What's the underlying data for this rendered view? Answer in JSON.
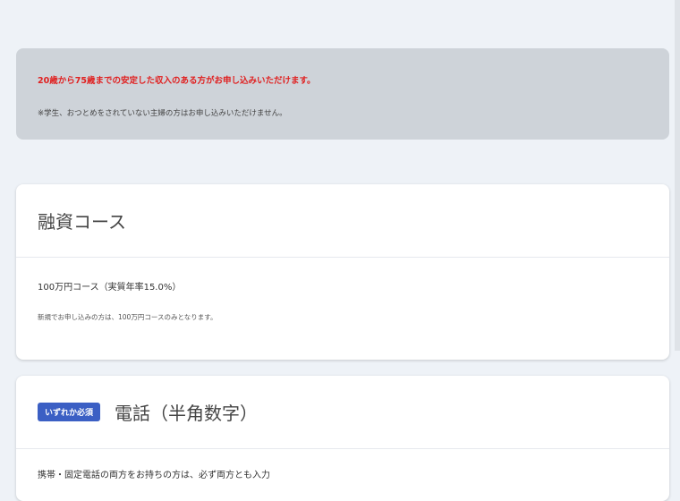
{
  "notice": {
    "warning": "20歳から75歳までの安定した収入のある方がお申し込みいただけます。",
    "sub": "※学生、おつとめをされていない主婦の方はお申し込みいただけません。"
  },
  "loan_course": {
    "title": "融資コース",
    "option": "100万円コース（実質年率15.0%）",
    "note": "新規でお申し込みの方は、100万円コースのみとなります。"
  },
  "phone": {
    "badge": "いずれか必須",
    "title": "電話（半角数字）",
    "instruction": "携帯・固定電話の両方をお持ちの方は、必ず両方とも入力"
  }
}
